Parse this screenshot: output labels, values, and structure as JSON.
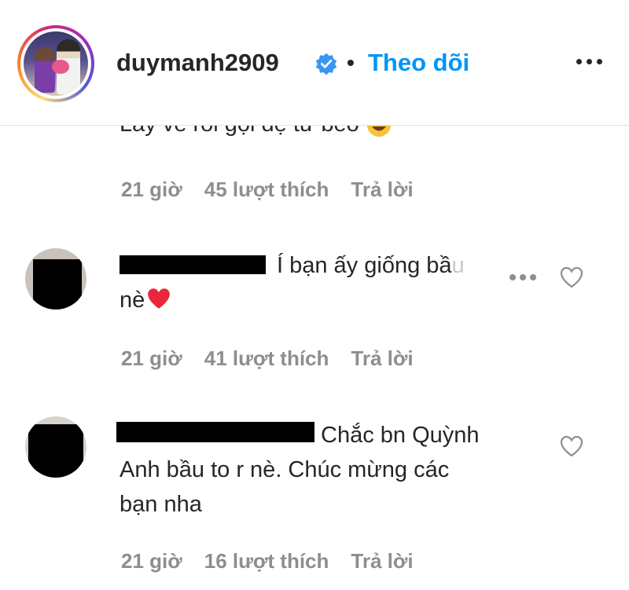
{
  "header": {
    "username": "duymanh2909",
    "separator": "•",
    "follow_label": "Theo dõi"
  },
  "top_comment": {
    "text_fragment": "Lấy vê rồi gọi đệ tử béo",
    "time": "21 giờ",
    "likes": "45 lượt thích",
    "reply": "Trả lời"
  },
  "comments": [
    {
      "text_line1": "Í bạn ấy giống bầ",
      "text_faded": "u",
      "text_line2": "nè",
      "emoji": "❤️",
      "time": "21 giờ",
      "likes": "41 lượt thích",
      "reply": "Trả lời"
    },
    {
      "text_line1": "Chắc bn Quỳnh",
      "text_line2": "Anh bầu to r nè. Chúc mừng các",
      "text_line3": "bạn nha",
      "time": "21 giờ",
      "likes": "16 lượt thích",
      "reply": "Trả lời"
    }
  ],
  "icons": {
    "verified": "verified-badge-icon",
    "more": "more-options-icon",
    "like": "heart-outline-icon",
    "emoji_top": "laughing-emoji-icon"
  },
  "colors": {
    "link_blue": "#0095f6",
    "muted_gray": "#8e8e8e",
    "text": "#262626"
  }
}
